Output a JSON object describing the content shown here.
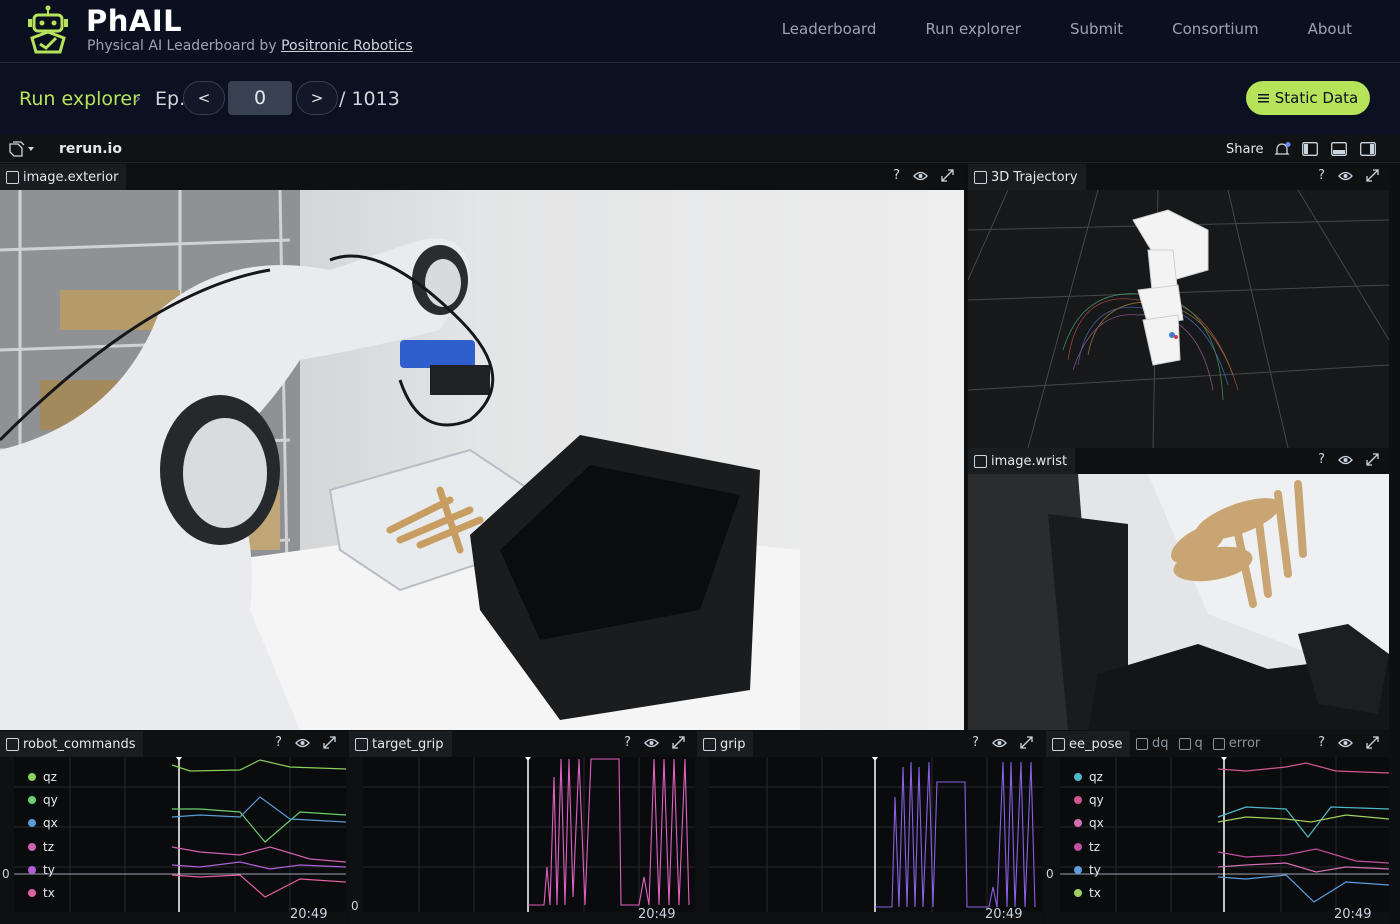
{
  "brand": {
    "title": "PhAIL",
    "subtitle_prefix": "Physical AI Leaderboard by ",
    "subtitle_link": "Positronic Robotics"
  },
  "nav": [
    "Leaderboard",
    "Run explorer",
    "Submit",
    "Consortium",
    "About"
  ],
  "runbar": {
    "crumb": "Run explorer",
    "ep_label": "Ep.",
    "prev": "<",
    "next": ">",
    "episode": "0",
    "total": "/ 1013",
    "static_data": "Static Data"
  },
  "rerun": {
    "name": "rerun.io",
    "share": "Share"
  },
  "panels": {
    "exterior": "image.exterior",
    "trajectory": "3D Trajectory",
    "wrist": "image.wrist",
    "robot_commands": "robot_commands",
    "target_grip": "target_grip",
    "grip": "grip",
    "ee_pose": "ee_pose",
    "ee_extra_tabs": [
      "dq",
      "q",
      "error"
    ]
  },
  "tools": {
    "help": "?"
  },
  "plots": {
    "zero_label": "0",
    "time_label": "20:49",
    "robot_commands_legend": [
      {
        "name": "qz",
        "color": "#8ad05c"
      },
      {
        "name": "qy",
        "color": "#6bcf6b"
      },
      {
        "name": "qx",
        "color": "#5b9bd5"
      },
      {
        "name": "tz",
        "color": "#d060b0"
      },
      {
        "name": "ty",
        "color": "#b060d8"
      },
      {
        "name": "tx",
        "color": "#e060a0"
      }
    ],
    "ee_pose_legend": [
      {
        "name": "qz",
        "color": "#4fb8c8"
      },
      {
        "name": "qy",
        "color": "#d05890"
      },
      {
        "name": "qx",
        "color": "#d070b0"
      },
      {
        "name": "tz",
        "color": "#c050a0"
      },
      {
        "name": "ty",
        "color": "#5aa0e0"
      },
      {
        "name": "tx",
        "color": "#a0d060"
      }
    ]
  },
  "colors": {
    "accent": "#b7e35a",
    "target_grip_line": "#e060c0",
    "grip_line": "#8a60e0"
  }
}
